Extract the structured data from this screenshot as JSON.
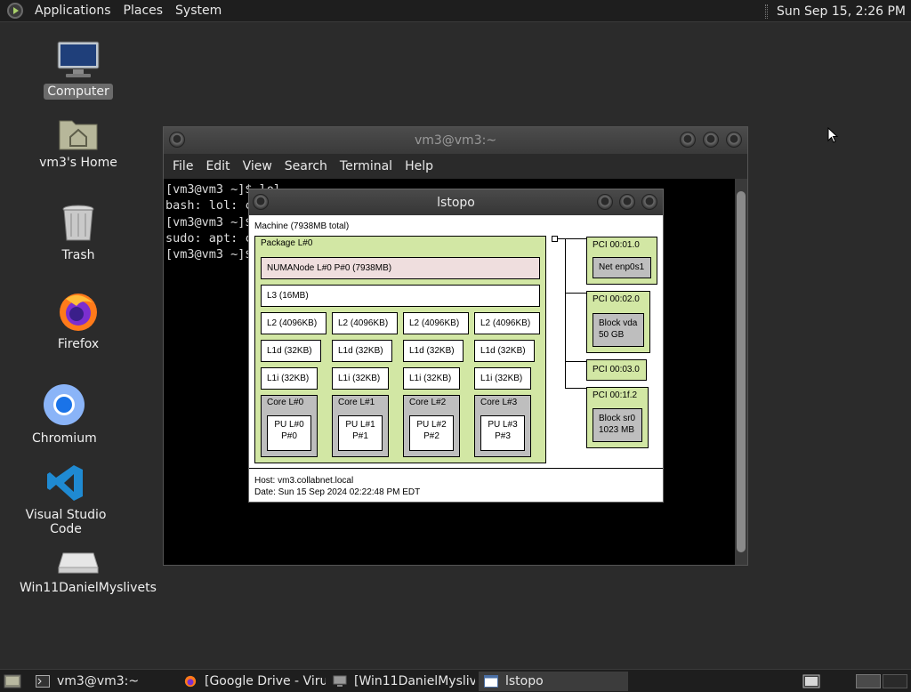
{
  "top_panel": {
    "menus": [
      "Applications",
      "Places",
      "System"
    ],
    "clock": "Sun Sep 15,  2:26 PM"
  },
  "desktop": {
    "icons": [
      {
        "name": "computer",
        "label": "Computer",
        "icon": "monitor-icon"
      },
      {
        "name": "home",
        "label": "vm3's Home",
        "icon": "home-folder-icon"
      },
      {
        "name": "trash",
        "label": "Trash",
        "icon": "trash-icon"
      },
      {
        "name": "firefox",
        "label": "Firefox",
        "icon": "firefox-icon"
      },
      {
        "name": "chromium",
        "label": "Chromium",
        "icon": "chromium-icon"
      },
      {
        "name": "vscode",
        "label": "Visual Studio Code",
        "icon": "vscode-icon"
      },
      {
        "name": "drive",
        "label": "Win11DanielMyslivets",
        "icon": "drive-icon"
      }
    ]
  },
  "terminal": {
    "title": "vm3@vm3:~",
    "menu": [
      "File",
      "Edit",
      "View",
      "Search",
      "Terminal",
      "Help"
    ],
    "lines": [
      "[vm3@vm3 ~]$ lol",
      "bash: lol: c",
      "[vm3@vm3 ~]$",
      "sudo: apt: c",
      "[vm3@vm3 ~]$"
    ]
  },
  "lstopo": {
    "title": "lstopo",
    "machine": "Machine (7938MB total)",
    "package": "Package L#0",
    "numa": "NUMANode L#0 P#0 (7938MB)",
    "l3": "L3 (16MB)",
    "l2": [
      "L2 (4096KB)",
      "L2 (4096KB)",
      "L2 (4096KB)",
      "L2 (4096KB)"
    ],
    "l1d": [
      "L1d (32KB)",
      "L1d (32KB)",
      "L1d (32KB)",
      "L1d (32KB)"
    ],
    "l1i": [
      "L1i (32KB)",
      "L1i (32KB)",
      "L1i (32KB)",
      "L1i (32KB)"
    ],
    "cores": [
      {
        "core": "Core L#0",
        "pu": "PU L#0",
        "p": "P#0"
      },
      {
        "core": "Core L#1",
        "pu": "PU L#1",
        "p": "P#1"
      },
      {
        "core": "Core L#2",
        "pu": "PU L#2",
        "p": "P#2"
      },
      {
        "core": "Core L#3",
        "pu": "PU L#3",
        "p": "P#3"
      }
    ],
    "pci": [
      {
        "label": "PCI 00:01.0",
        "dev1": "Net enp0s1",
        "dev2": ""
      },
      {
        "label": "PCI 00:02.0",
        "dev1": "Block vda",
        "dev2": "50 GB"
      },
      {
        "label": "PCI 00:03.0",
        "dev1": "",
        "dev2": ""
      },
      {
        "label": "PCI 00:1f.2",
        "dev1": "Block sr0",
        "dev2": "1023 MB"
      }
    ],
    "host": "Host: vm3.collabnet.local",
    "date": "Date: Sun 15 Sep 2024 02:22:48 PM EDT"
  },
  "taskbar": {
    "tasks": [
      {
        "label": "vm3@vm3:~",
        "icon": "terminal-icon"
      },
      {
        "label": "[Google Drive - Viru...",
        "icon": "firefox-icon"
      },
      {
        "label": "[Win11DanielMysliv...",
        "icon": "vm-icon"
      },
      {
        "label": "lstopo",
        "icon": "window-icon"
      }
    ]
  }
}
